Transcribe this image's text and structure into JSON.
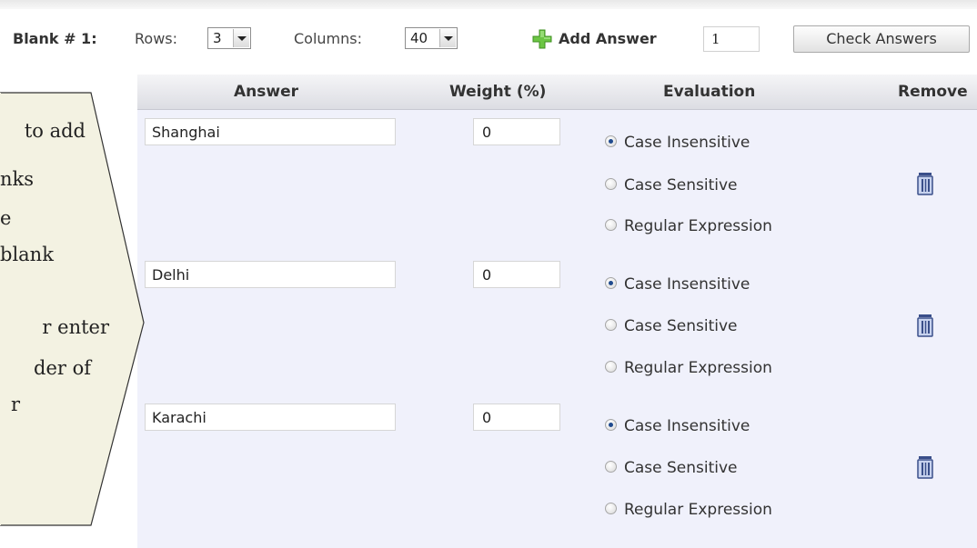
{
  "toolbar": {
    "blank_label": "Blank # 1:",
    "rows_label": "Rows:",
    "rows_value": "3",
    "columns_label": "Columns:",
    "columns_value": "40",
    "add_answer_label": "Add Answer",
    "add_answer_count": "1",
    "check_answers_label": "Check Answers"
  },
  "table": {
    "headers": [
      "Answer",
      "Weight (%)",
      "Evaluation",
      "Remove"
    ],
    "rows": [
      {
        "answer": "Shanghai",
        "weight": "0",
        "evaluation": "Case Insensitive"
      },
      {
        "answer": "Delhi",
        "weight": "0",
        "evaluation": "Case Insensitive"
      },
      {
        "answer": "Karachi",
        "weight": "0",
        "evaluation": "Case Insensitive"
      }
    ],
    "evaluation_options": [
      "Case Insensitive",
      "Case Sensitive",
      "Regular Expression"
    ]
  },
  "callout": {
    "lines": [
      "to add",
      "nks",
      "e",
      "blank",
      "",
      "r enter",
      "der of",
      "r"
    ]
  },
  "icons": {
    "add": "plus-icon",
    "remove": "trash-icon",
    "accent_green": "#5fbf3a",
    "trash_blue": "#3a4f8a",
    "panel_bg": "#f0f1fb"
  }
}
